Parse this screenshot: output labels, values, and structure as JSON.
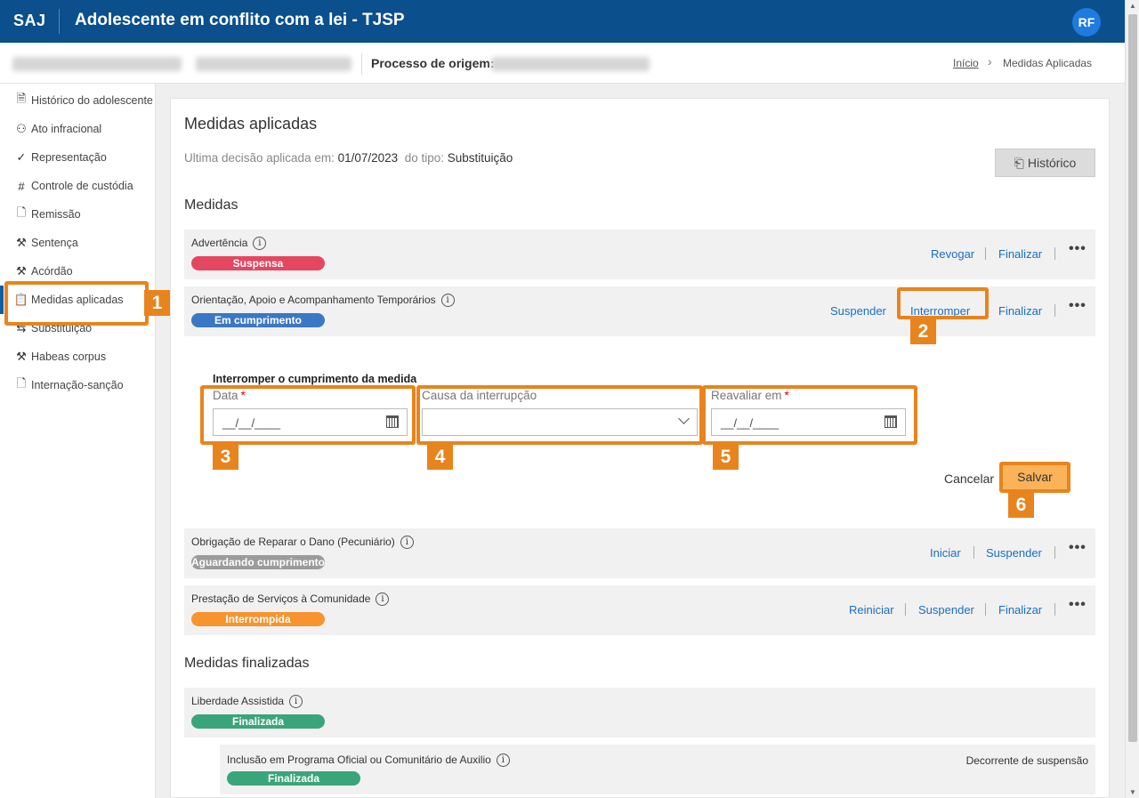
{
  "header": {
    "logo": "SAJ",
    "title": "Adolescente em conflito com a lei - TJSP",
    "avatar_initials": "RF",
    "color": "#0b4f8c"
  },
  "subheader": {
    "processo_label": "Processo de origem:"
  },
  "breadcrumb": {
    "home": "Início",
    "current": "Medidas Aplicadas"
  },
  "sidebar": {
    "items": [
      {
        "label": "Histórico do adolescente",
        "icon": "document-icon"
      },
      {
        "label": "Ato infracional",
        "icon": "person-icon"
      },
      {
        "label": "Representação",
        "icon": "check-icon"
      },
      {
        "label": "Controle de custódia",
        "icon": "grid-icon"
      },
      {
        "label": "Remissão",
        "icon": "document-edit-icon"
      },
      {
        "label": "Sentença",
        "icon": "gavel-icon"
      },
      {
        "label": "Acórdão",
        "icon": "gavel-icon"
      },
      {
        "label": "Medidas aplicadas",
        "icon": "clipboard-icon"
      },
      {
        "label": "Substituição",
        "icon": "swap-icon"
      },
      {
        "label": "Habeas corpus",
        "icon": "gavel-icon"
      },
      {
        "label": "Internação-sanção",
        "icon": "document-edit-icon"
      }
    ]
  },
  "main": {
    "title": "Medidas aplicadas",
    "last_decision_label": "Ultima decisão aplicada em:",
    "last_decision_date": "01/07/2023",
    "type_label": "do tipo:",
    "type_value": "Substituição",
    "history_button": "Histórico",
    "measures_title": "Medidas",
    "finalized_title": "Medidas finalizadas"
  },
  "measures": [
    {
      "name": "Advertência",
      "status": "Suspensa",
      "status_color": "#e4475f",
      "actions": [
        "Revogar",
        "Finalizar"
      ]
    },
    {
      "name": "Orientação, Apoio e Acompanhamento Temporários",
      "status": "Em cumprimento",
      "status_color": "#3a78c4",
      "actions": [
        "Suspender",
        "Interromper",
        "Finalizar"
      ]
    },
    {
      "name": "Obrigação de Reparar o Dano (Pecuniário)",
      "status": "Aguardando cumprimento",
      "status_color": "#9b9b9b",
      "actions": [
        "Iniciar",
        "Suspender"
      ]
    },
    {
      "name": "Prestação de Serviços à Comunidade",
      "status": "Interrompida",
      "status_color": "#f7942f",
      "actions": [
        "Reiniciar",
        "Suspender",
        "Finalizar"
      ]
    }
  ],
  "interrupt_form": {
    "title": "Interromper o cumprimento da medida",
    "date_label": "Data",
    "date_placeholder": "__/__/____",
    "cause_label": "Causa da interrupção",
    "reassess_label": "Reavaliar em",
    "reassess_placeholder": "__/__/____",
    "required_mark": "*",
    "cancel": "Cancelar",
    "save": "Salvar"
  },
  "finalized": [
    {
      "name": "Liberdade Assistida",
      "status": "Finalizada",
      "status_color": "#3aa57a"
    },
    {
      "name": "Inclusão em Programa Oficial ou Comunitário de Auxilio",
      "status": "Finalizada",
      "status_color": "#3aa57a",
      "note": "Decorrente de suspensão"
    }
  ],
  "annotations": [
    "1",
    "2",
    "3",
    "4",
    "5",
    "6"
  ],
  "accent": "#e8841d"
}
